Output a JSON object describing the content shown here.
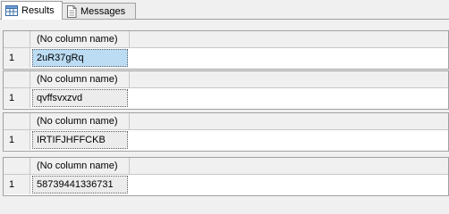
{
  "tabs": [
    {
      "label": "Results",
      "icon": "grid-icon",
      "active": true
    },
    {
      "label": "Messages",
      "icon": "document-icon",
      "active": false
    }
  ],
  "result_sets": [
    {
      "column_header": "(No column name)",
      "row_number": "1",
      "value": "2uR37gRq",
      "selected": true
    },
    {
      "column_header": "(No column name)",
      "row_number": "1",
      "value": "qvffsvxzvd",
      "selected": false
    },
    {
      "column_header": "(No column name)",
      "row_number": "1",
      "value": "IRTIFJHFFCKB",
      "selected": false
    },
    {
      "column_header": "(No column name)",
      "row_number": "1",
      "value": "58739441336731",
      "selected": false
    }
  ]
}
